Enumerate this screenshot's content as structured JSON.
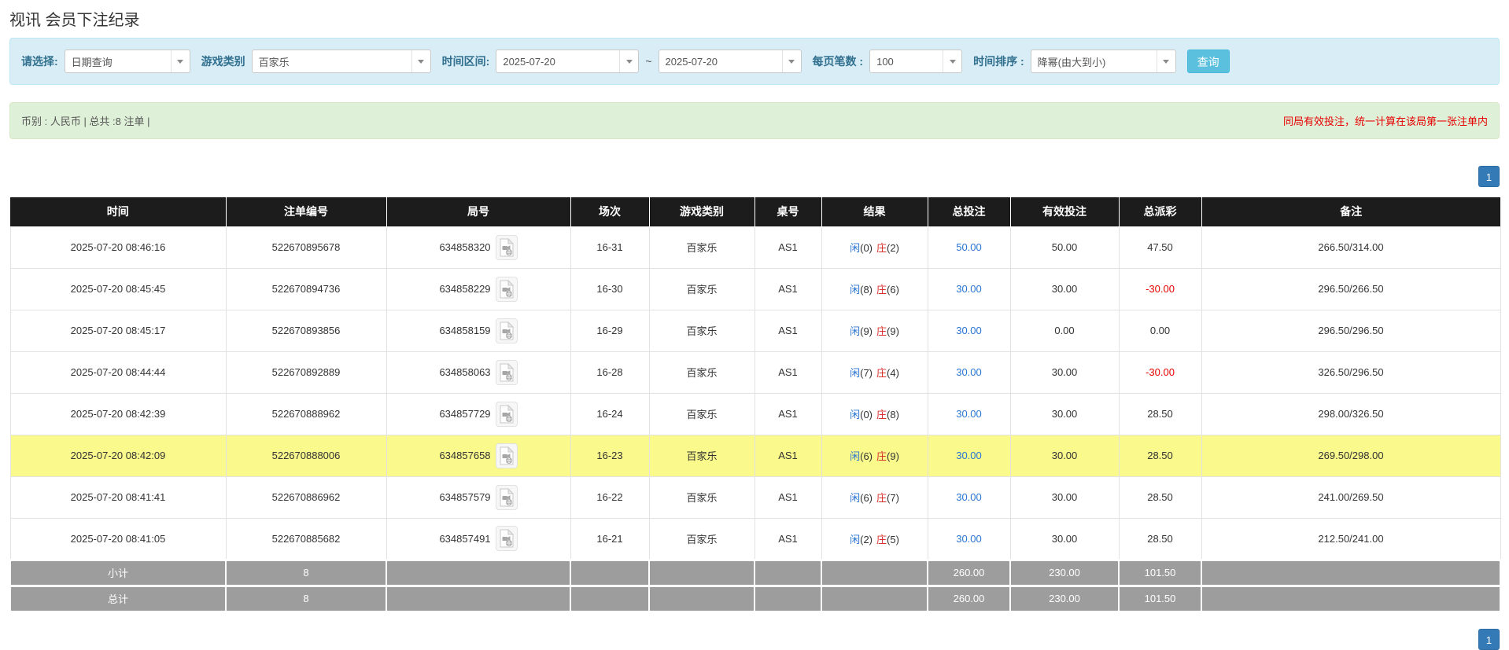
{
  "title": "视讯 会员下注纪录",
  "colors": {
    "accent_light_blue": "#5bc0de",
    "pager_blue": "#337ab7",
    "link_blue": "#2a76d2",
    "banker_red": "#d9302c",
    "note_red": "#e60000",
    "filter_bg": "#d9edf7",
    "summary_bg": "#dff0d8",
    "header_bg": "#1c1c1c",
    "footer_bg": "#9d9d9d",
    "highlight_yellow": "#f9f98c"
  },
  "filters": {
    "query_type_label": "请选择:",
    "query_type_value": "日期查询",
    "game_category_label": "游戏类别",
    "game_category_value": "百家乐",
    "time_range_label": "时间区间:",
    "date_from": "2025-07-20",
    "range_separator": "~",
    "date_to": "2025-07-20",
    "page_size_label": "每页笔数 :",
    "page_size_value": "100",
    "time_order_label": "时间排序 :",
    "time_order_value": "降幂(由大到小)",
    "search_button_label": "查询"
  },
  "summary_bar": {
    "left_text": "币别 : 人民币 | 总共 :8 注单 |",
    "right_note": "同局有效投注，统一计算在该局第一张注单内"
  },
  "pagination": {
    "current_page": "1"
  },
  "table": {
    "headers": {
      "time": "时间",
      "bet_id": "注单编号",
      "round_id": "局号",
      "session": "场次",
      "game": "游戏类别",
      "table_no": "桌号",
      "result": "结果",
      "total_bet": "总投注",
      "valid_bet": "有效投注",
      "payout": "总派彩",
      "remark": "备注"
    },
    "result_labels": {
      "player": "闲",
      "banker": "庄"
    },
    "rows": [
      {
        "time": "2025-07-20 08:46:16",
        "bet_id": "522670895678",
        "round_id": "634858320",
        "session": "16-31",
        "game": "百家乐",
        "table_no": "AS1",
        "player": "0",
        "banker": "2",
        "total_bet": "50.00",
        "valid_bet": "50.00",
        "payout": "47.50",
        "payout_negative": false,
        "remark": "266.50/314.00",
        "highlighted": false
      },
      {
        "time": "2025-07-20 08:45:45",
        "bet_id": "522670894736",
        "round_id": "634858229",
        "session": "16-30",
        "game": "百家乐",
        "table_no": "AS1",
        "player": "8",
        "banker": "6",
        "total_bet": "30.00",
        "valid_bet": "30.00",
        "payout": "-30.00",
        "payout_negative": true,
        "remark": "296.50/266.50",
        "highlighted": false
      },
      {
        "time": "2025-07-20 08:45:17",
        "bet_id": "522670893856",
        "round_id": "634858159",
        "session": "16-29",
        "game": "百家乐",
        "table_no": "AS1",
        "player": "9",
        "banker": "9",
        "total_bet": "30.00",
        "valid_bet": "0.00",
        "payout": "0.00",
        "payout_negative": false,
        "remark": "296.50/296.50",
        "highlighted": false
      },
      {
        "time": "2025-07-20 08:44:44",
        "bet_id": "522670892889",
        "round_id": "634858063",
        "session": "16-28",
        "game": "百家乐",
        "table_no": "AS1",
        "player": "7",
        "banker": "4",
        "total_bet": "30.00",
        "valid_bet": "30.00",
        "payout": "-30.00",
        "payout_negative": true,
        "remark": "326.50/296.50",
        "highlighted": false
      },
      {
        "time": "2025-07-20 08:42:39",
        "bet_id": "522670888962",
        "round_id": "634857729",
        "session": "16-24",
        "game": "百家乐",
        "table_no": "AS1",
        "player": "0",
        "banker": "8",
        "total_bet": "30.00",
        "valid_bet": "30.00",
        "payout": "28.50",
        "payout_negative": false,
        "remark": "298.00/326.50",
        "highlighted": false
      },
      {
        "time": "2025-07-20 08:42:09",
        "bet_id": "522670888006",
        "round_id": "634857658",
        "session": "16-23",
        "game": "百家乐",
        "table_no": "AS1",
        "player": "6",
        "banker": "9",
        "total_bet": "30.00",
        "valid_bet": "30.00",
        "payout": "28.50",
        "payout_negative": false,
        "remark": "269.50/298.00",
        "highlighted": true
      },
      {
        "time": "2025-07-20 08:41:41",
        "bet_id": "522670886962",
        "round_id": "634857579",
        "session": "16-22",
        "game": "百家乐",
        "table_no": "AS1",
        "player": "6",
        "banker": "7",
        "total_bet": "30.00",
        "valid_bet": "30.00",
        "payout": "28.50",
        "payout_negative": false,
        "remark": "241.00/269.50",
        "highlighted": false
      },
      {
        "time": "2025-07-20 08:41:05",
        "bet_id": "522670885682",
        "round_id": "634857491",
        "session": "16-21",
        "game": "百家乐",
        "table_no": "AS1",
        "player": "2",
        "banker": "5",
        "total_bet": "30.00",
        "valid_bet": "30.00",
        "payout": "28.50",
        "payout_negative": false,
        "remark": "212.50/241.00",
        "highlighted": false
      }
    ],
    "subtotal": {
      "label": "小计",
      "count": "8",
      "total_bet": "260.00",
      "valid_bet": "230.00",
      "payout": "101.50"
    },
    "grand_total": {
      "label": "总计",
      "count": "8",
      "total_bet": "260.00",
      "valid_bet": "230.00",
      "payout": "101.50"
    }
  }
}
